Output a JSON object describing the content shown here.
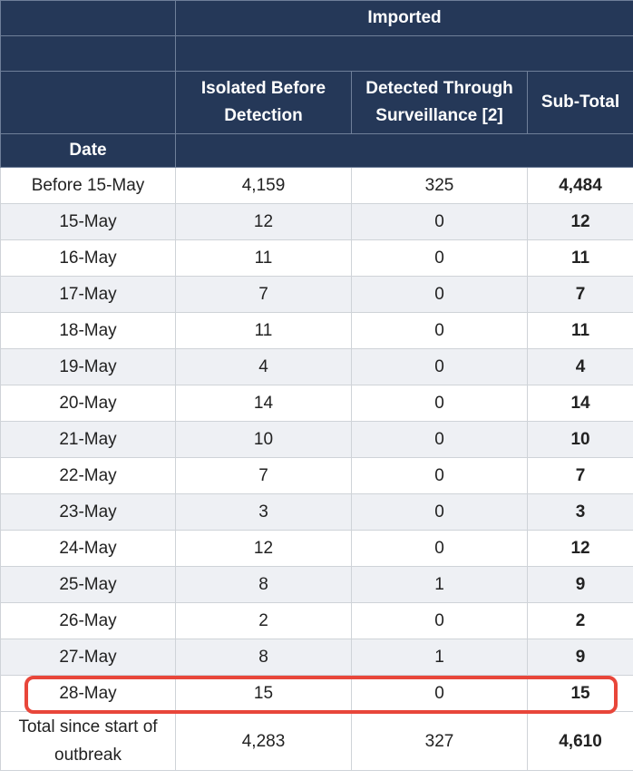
{
  "header": {
    "group_label": "Imported",
    "columns": {
      "isolated": "Isolated Before Detection",
      "detected": "Detected Through Surveillance [2]",
      "subtotal": "Sub-Total"
    },
    "date_label": "Date"
  },
  "rows": [
    {
      "date": "Before 15-May",
      "isolated": "4,159",
      "detected": "325",
      "subtotal": "4,484"
    },
    {
      "date": "15-May",
      "isolated": "12",
      "detected": "0",
      "subtotal": "12"
    },
    {
      "date": "16-May",
      "isolated": "11",
      "detected": "0",
      "subtotal": "11"
    },
    {
      "date": "17-May",
      "isolated": "7",
      "detected": "0",
      "subtotal": "7"
    },
    {
      "date": "18-May",
      "isolated": "11",
      "detected": "0",
      "subtotal": "11"
    },
    {
      "date": "19-May",
      "isolated": "4",
      "detected": "0",
      "subtotal": "4"
    },
    {
      "date": "20-May",
      "isolated": "14",
      "detected": "0",
      "subtotal": "14"
    },
    {
      "date": "21-May",
      "isolated": "10",
      "detected": "0",
      "subtotal": "10"
    },
    {
      "date": "22-May",
      "isolated": "7",
      "detected": "0",
      "subtotal": "7"
    },
    {
      "date": "23-May",
      "isolated": "3",
      "detected": "0",
      "subtotal": "3"
    },
    {
      "date": "24-May",
      "isolated": "12",
      "detected": "0",
      "subtotal": "12"
    },
    {
      "date": "25-May",
      "isolated": "8",
      "detected": "1",
      "subtotal": "9"
    },
    {
      "date": "26-May",
      "isolated": "2",
      "detected": "0",
      "subtotal": "2"
    },
    {
      "date": "27-May",
      "isolated": "8",
      "detected": "1",
      "subtotal": "9"
    },
    {
      "date": "28-May",
      "isolated": "15",
      "detected": "0",
      "subtotal": "15"
    }
  ],
  "total": {
    "label": "Total since start of outbreak",
    "isolated": "4,283",
    "detected": "327",
    "subtotal": "4,610"
  },
  "colors": {
    "header_bg": "#253858",
    "header_text": "#ffffff",
    "row_stripe": "#eef0f4",
    "highlight": "#e8463a"
  }
}
